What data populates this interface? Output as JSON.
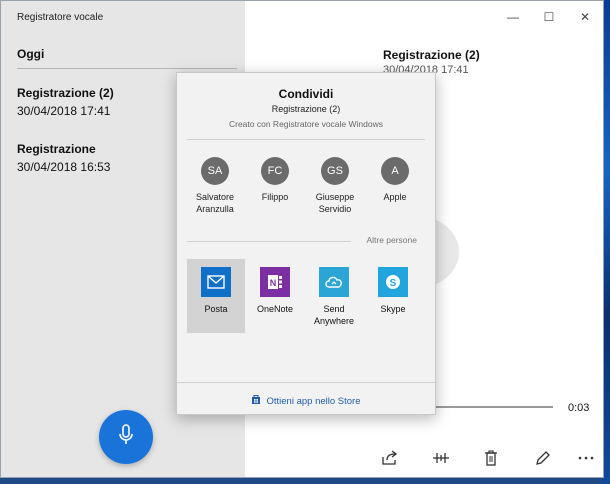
{
  "window": {
    "title": "Registratore vocale",
    "controls": {
      "minimize": "—",
      "maximize": "☐",
      "close": "✕"
    }
  },
  "sidebar": {
    "section_header": "Oggi",
    "recordings": [
      {
        "name": "Registrazione (2)",
        "date": "30/04/2018 17:41"
      },
      {
        "name": "Registrazione",
        "date": "30/04/2018 16:53"
      }
    ]
  },
  "detail": {
    "title": "Registrazione (2)",
    "date": "30/04/2018 17:41",
    "time_readout": "0:03"
  },
  "share": {
    "title": "Condividi",
    "subtitle": "Registrazione (2)",
    "caption": "Creato con Registratore vocale Windows",
    "contacts": [
      {
        "initials": "SA",
        "name_line1": "Salvatore",
        "name_line2": "Aranzulla"
      },
      {
        "initials": "FC",
        "name_line1": "Filippo",
        "name_line2": ""
      },
      {
        "initials": "GS",
        "name_line1": "Giuseppe",
        "name_line2": "Servidio"
      },
      {
        "initials": "A",
        "name_line1": "Apple",
        "name_line2": ""
      }
    ],
    "altre_persone": "Altre persone",
    "apps": [
      {
        "name_line1": "Posta",
        "name_line2": "",
        "icon": "mail-icon",
        "color": "#1070c8"
      },
      {
        "name_line1": "OneNote",
        "name_line2": "",
        "icon": "onenote-icon",
        "color": "#7b2fa3"
      },
      {
        "name_line1": "Send",
        "name_line2": "Anywhere",
        "icon": "send-anywhere-icon",
        "color": "#2aa5d6"
      },
      {
        "name_line1": "Skype",
        "name_line2": "",
        "icon": "skype-icon",
        "color": "#22a5dd"
      }
    ],
    "store_link": "Ottieni app nello Store"
  },
  "colors": {
    "accent": "#1a73d9",
    "sidebar_bg": "#e6e6e6",
    "flyout_bg": "#f2f2f2",
    "avatar_bg": "#6b6b6b",
    "link": "#1f5fa8"
  }
}
